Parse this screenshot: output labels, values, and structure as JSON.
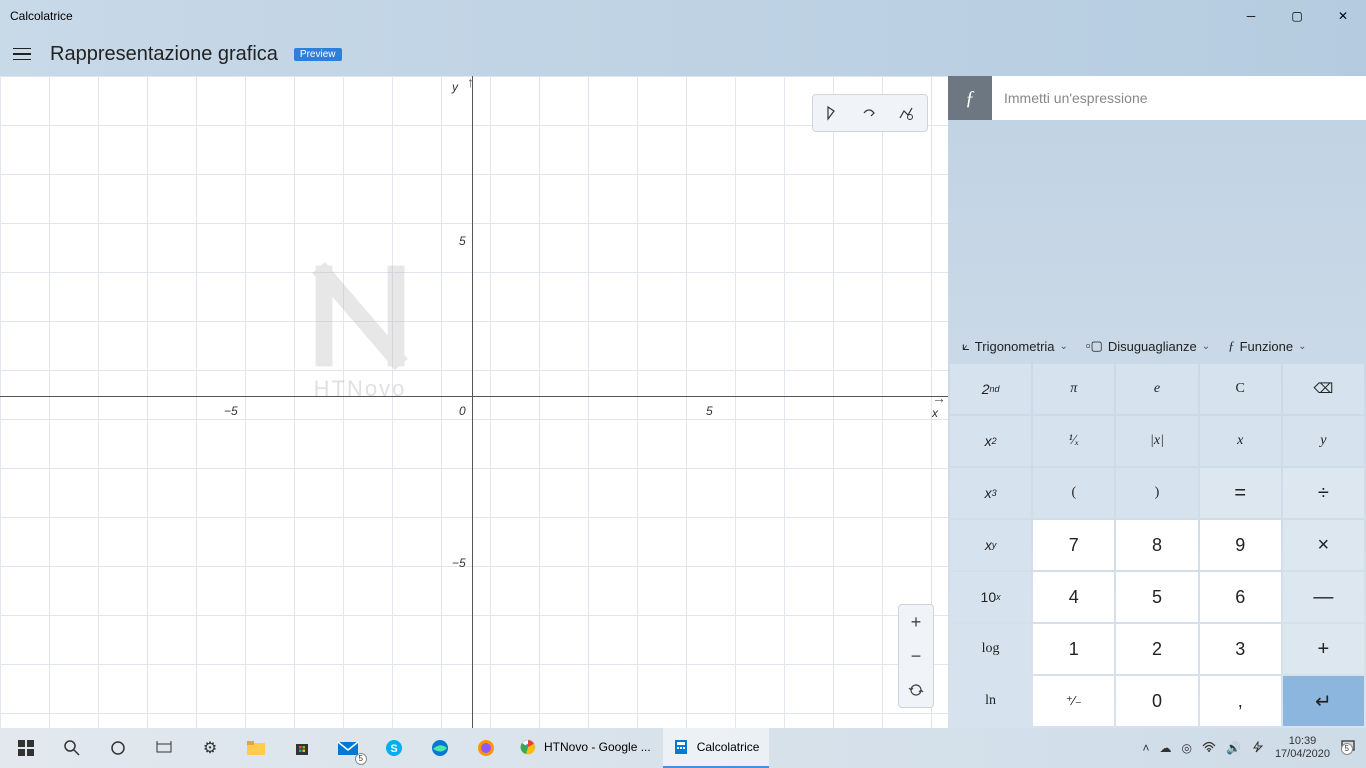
{
  "titlebar": {
    "title": "Calcolatrice"
  },
  "header": {
    "title": "Rappresentazione grafica",
    "badge": "Preview"
  },
  "graph": {
    "x_label": "x",
    "y_label": "y",
    "ticks": {
      "neg_x": "−5",
      "pos_x": "5",
      "neg_y": "−5",
      "pos_y": "5",
      "origin": "0"
    },
    "watermark": "HTNovo"
  },
  "fx": {
    "placeholder": "Immetti un'espressione"
  },
  "func_row": {
    "trig": "Trigonometria",
    "ineq": "Disuguaglianze",
    "func": "Funzione"
  },
  "keys": {
    "second": "2",
    "second_sup": "nd",
    "pi": "π",
    "e": "e",
    "clear": "C",
    "backspace": "⌫",
    "x2_base": "x",
    "x2_sup": "2",
    "recip": "¹∕ₓ",
    "abs": "|x|",
    "x": "x",
    "y": "y",
    "x3_base": "x",
    "x3_sup": "3",
    "lpar": "(",
    "rpar": ")",
    "eq": "=",
    "div": "÷",
    "xy_base": "x",
    "xy_sup": "y",
    "n7": "7",
    "n8": "8",
    "n9": "9",
    "mul": "×",
    "tenx_base": "10",
    "tenx_sup": "x",
    "n4": "4",
    "n5": "5",
    "n6": "6",
    "sub": "—",
    "log": "log",
    "n1": "1",
    "n2": "2",
    "n3": "3",
    "add": "+",
    "ln": "ln",
    "plusminus": "⁺∕₋",
    "n0": "0",
    "comma": ",",
    "enter": "↵"
  },
  "taskbar": {
    "apps": [
      {
        "label": "HTNovo - Google ..."
      },
      {
        "label": "Calcolatrice"
      }
    ],
    "time": "10:39",
    "date": "17/04/2020",
    "mail_badge": "5",
    "notif_badge": "5"
  }
}
